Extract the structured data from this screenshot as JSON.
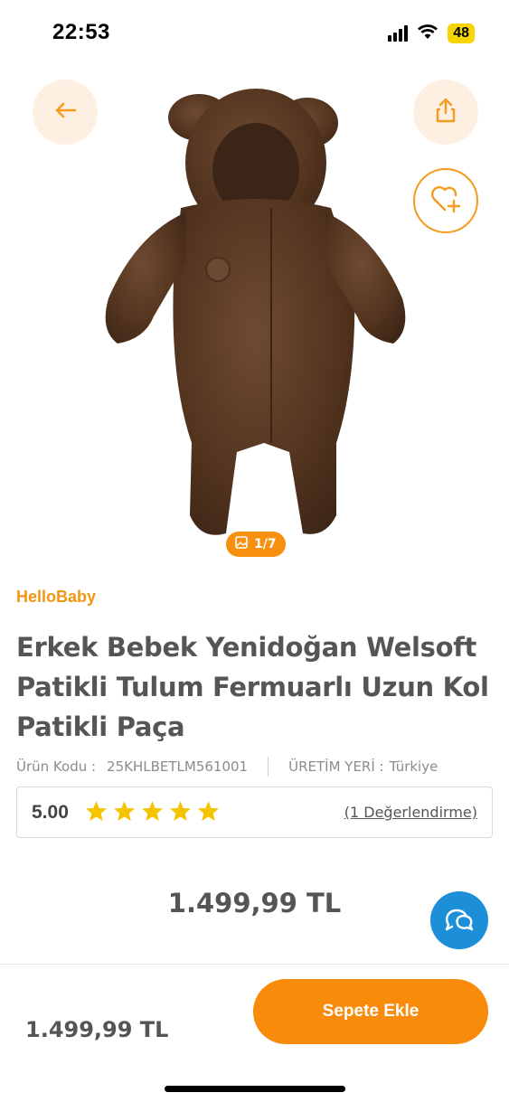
{
  "status_bar": {
    "time": "22:53",
    "battery": "48"
  },
  "gallery": {
    "counter": "1/7"
  },
  "product": {
    "brand": "HelloBaby",
    "title": "Erkek Bebek Yenidoğan Welsoft Patikli Tulum Fermuarlı Uzun Kol Patikli Paça",
    "code_label": "Ürün Kodu :",
    "code_value": "25KHLBETLM561001",
    "origin_label": "ÜRETİM YERİ :",
    "origin_value": "Türkiye",
    "rating": "5.00",
    "rating_stars": 5,
    "reviews_link": "(1 Değerlendirme)",
    "price": "1.499,99 TL"
  },
  "bottom_bar": {
    "price": "1.499,99 TL",
    "add_to_cart_label": "Sepete Ekle"
  },
  "colors": {
    "accent": "#f98b0b",
    "brand": "#f2960f",
    "chat": "#1d8fd8",
    "star": "#f5c400"
  },
  "icons": [
    "back-arrow-icon",
    "share-icon",
    "heart-plus-icon",
    "image-icon",
    "star-icon",
    "chat-icon",
    "signal-icon",
    "wifi-icon"
  ]
}
